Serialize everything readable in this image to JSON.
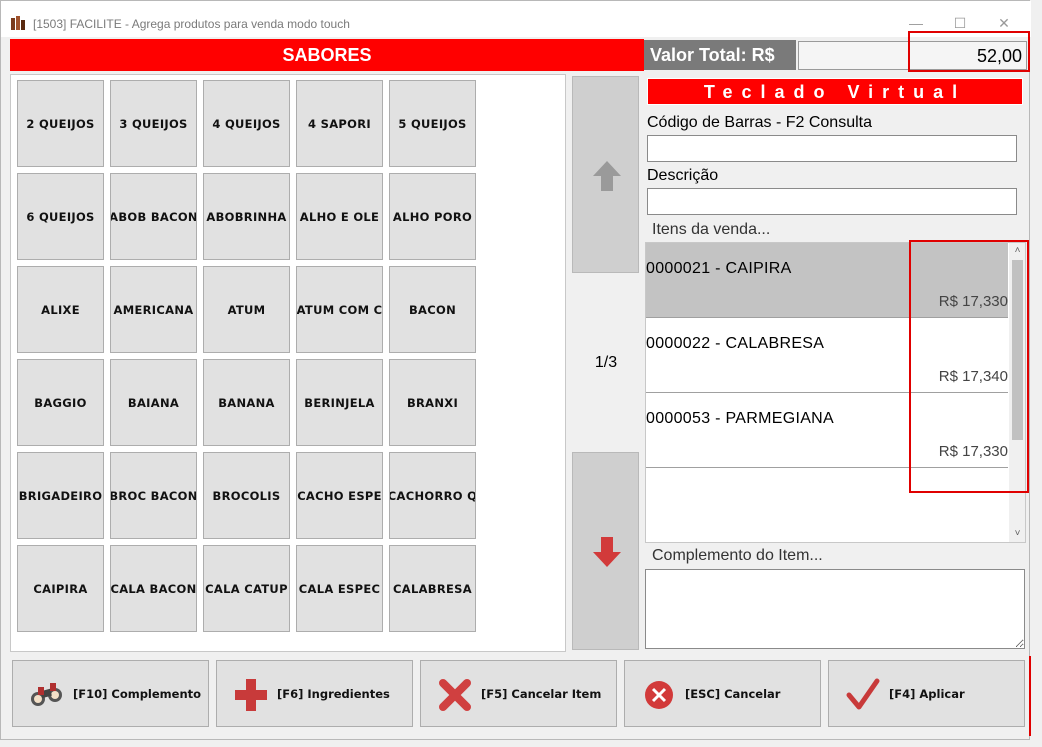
{
  "window": {
    "title": "[1503] FACILITE - Agrega produtos para venda modo touch",
    "controls": [
      "—",
      "☐",
      "✕"
    ]
  },
  "sabores": {
    "header": "SABORES",
    "items": [
      "2 QUEIJOS",
      "3 QUEIJOS",
      "4 QUEIJOS",
      "4 SAPORI",
      "5 QUEIJOS",
      "6 QUEIJOS",
      "ABOB BACON",
      "ABOBRINHA",
      "ALHO E OLE",
      "ALHO PORO",
      "ALIXE",
      "AMERICANA",
      "ATUM",
      "ATUM COM C",
      "BACON",
      "BAGGIO",
      "BAIANA",
      "BANANA",
      "BERINJELA",
      "BRANXI",
      "BRIGADEIRO",
      "BROC BACON",
      "BROCOLIS",
      "CACHO ESPE",
      "CACHORRO Q",
      "CAIPIRA",
      "CALA BACON",
      "CALA CATUP",
      "CALA ESPEC",
      "CALABRESA"
    ]
  },
  "pager": {
    "page": "1/3",
    "up_icon": "arrow-up-icon",
    "down_icon": "arrow-down-icon"
  },
  "total": {
    "label": "Valor Total: R$",
    "value": "52,00"
  },
  "keyboard": {
    "title": "Teclado Virtual"
  },
  "barcode": {
    "label": "Código de Barras - F2 Consulta",
    "value": ""
  },
  "description": {
    "label": "Descrição",
    "value": ""
  },
  "sale_items": {
    "title": "Itens da venda...",
    "items": [
      {
        "name": "0000021 - CAIPIRA",
        "price": "R$ 17,330"
      },
      {
        "name": "0000022 - CALABRESA",
        "price": "R$ 17,340"
      },
      {
        "name": "0000053 - PARMEGIANA",
        "price": "R$ 17,330"
      }
    ]
  },
  "complement": {
    "title": "Complemento do Item...",
    "value": ""
  },
  "actions": [
    {
      "label": "[F10] Complemento",
      "icon": "binoculars-icon"
    },
    {
      "label": "[F6] Ingredientes",
      "icon": "plus-icon"
    },
    {
      "label": "[F5] Cancelar Item",
      "icon": "x-cross-icon"
    },
    {
      "label": "[ESC] Cancelar",
      "icon": "cancel-circle-icon"
    },
    {
      "label": "[F4] Aplicar",
      "icon": "checkmark-icon"
    }
  ],
  "colors": {
    "accent": "#ff0000",
    "selected_row": "#c3c3c3",
    "button_bg": "#e1e1e1"
  }
}
